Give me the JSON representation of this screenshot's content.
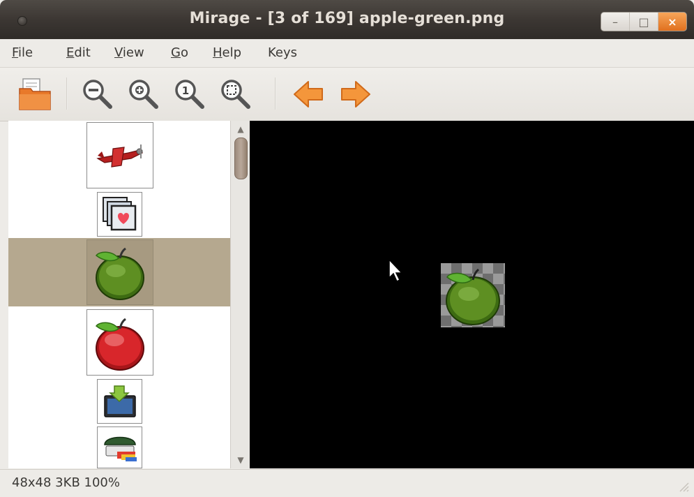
{
  "window": {
    "title": "Mirage - [3 of 169] apple-green.png",
    "controls": {
      "minimize": "–",
      "maximize": "□",
      "close": "×"
    }
  },
  "menubar": {
    "items": [
      {
        "label": "File",
        "mnemonic": "F",
        "rest": "ile"
      },
      {
        "label": "Edit",
        "mnemonic": "E",
        "rest": "dit"
      },
      {
        "label": "View",
        "mnemonic": "V",
        "rest": "iew"
      },
      {
        "label": "Go",
        "mnemonic": "G",
        "rest": "o"
      },
      {
        "label": "Help",
        "mnemonic": "H",
        "rest": "elp"
      },
      {
        "label": "Keys",
        "mnemonic": "",
        "rest": "Keys"
      }
    ]
  },
  "toolbar": {
    "buttons": [
      "open-folder-icon",
      "zoom-out-icon",
      "zoom-in-icon",
      "zoom-100-icon",
      "zoom-fit-icon",
      "previous-arrow-icon",
      "next-arrow-icon"
    ]
  },
  "thumbnails": {
    "selected_index": 2,
    "items": [
      "airplane",
      "image-stack-heart",
      "apple-green",
      "apple-red",
      "download-screen",
      "drive-stack"
    ]
  },
  "viewer": {
    "background": "#000000",
    "image": "apple-green"
  },
  "statusbar": {
    "text": "48x48   3KB   100%"
  },
  "colors": {
    "titlebar": "#3c3733",
    "selection": "#b5a88f",
    "accent_orange": "#f28c28"
  }
}
